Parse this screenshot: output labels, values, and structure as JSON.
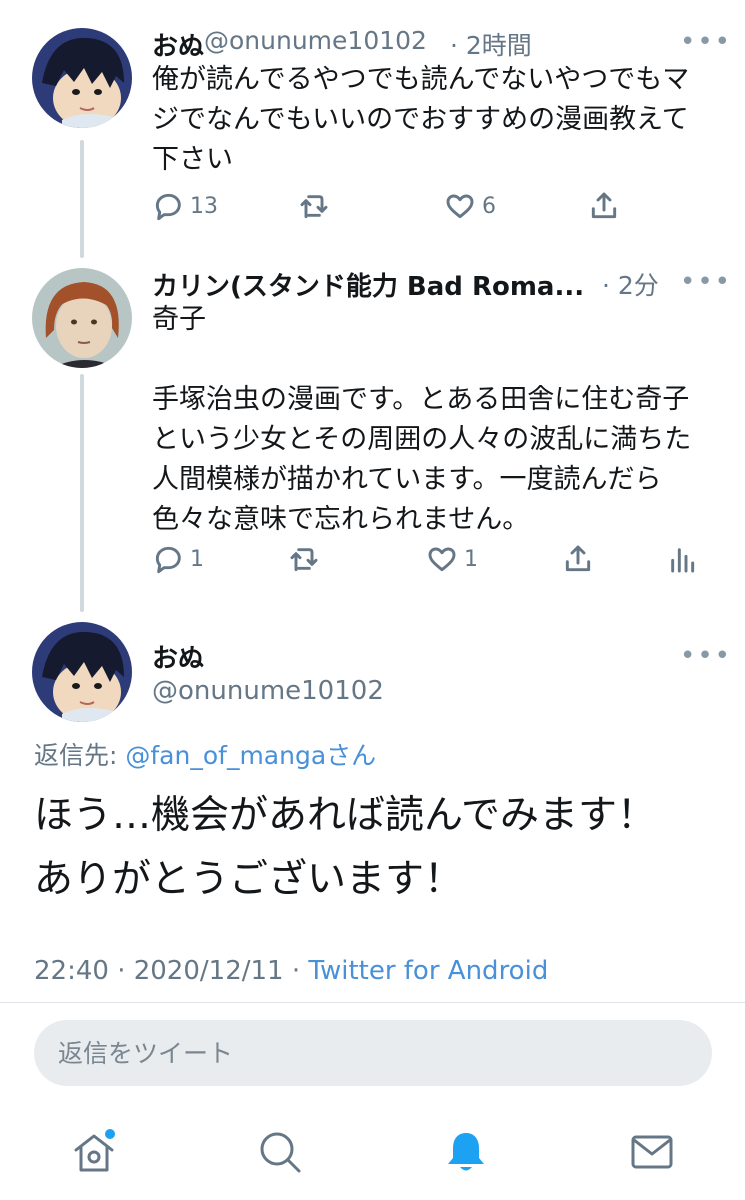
{
  "tweets": [
    {
      "name": "おぬ",
      "handle": "@onunume10102",
      "time": "· 2時間",
      "lines": [
        "俺が読んでるやつでも読んでないやつでもマ",
        "ジでなんでもいいのでおすすめの漫画教えて",
        "下さい"
      ],
      "reply_count": "13",
      "retweet_count": "",
      "like_count": "6"
    },
    {
      "name": "カリン(スタンド能力 Bad Roma...",
      "time": "· 2分",
      "lines": [
        "奇子",
        "",
        "手塚治虫の漫画です。とある田舎に住む奇子",
        "という少女とその周囲の人々の波乱に満ちた",
        "人間模様が描かれています。一度読んだら",
        "色々な意味で忘れられません。"
      ],
      "reply_count": "1",
      "like_count": "1"
    }
  ],
  "main_tweet": {
    "name": "おぬ",
    "handle": "@onunume10102",
    "replying_prefix": "返信先: ",
    "replying_to": "@fan_of_mangaさん",
    "lines": [
      "ほう…機会があれば読んでみます！",
      "ありがとうございます！"
    ],
    "timestamp": "22:40 · 2020/12/11 · ",
    "source": "Twitter for Android"
  },
  "reply_box": {
    "placeholder": "返信をツイート"
  },
  "bottom_nav": [
    "home-icon",
    "search-icon",
    "notifications-icon",
    "messages-icon"
  ],
  "colors": {
    "accent": "#1da1f2",
    "link": "#4a90d9",
    "muted": "#657786"
  }
}
